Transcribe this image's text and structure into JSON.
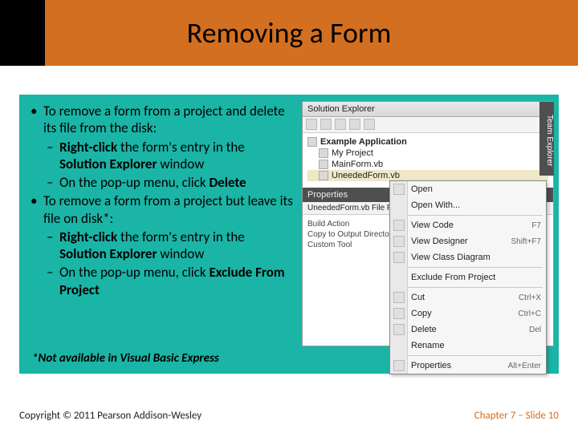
{
  "title": "Removing a Form",
  "bullets": {
    "b1a": "To remove a form from a project and delete its file from the disk:",
    "b1a_s1_pre": "Right-click ",
    "b1a_s1_mid": "the form's entry in the ",
    "b1a_s1_b2": "Solution Explorer ",
    "b1a_s1_post": "window",
    "b1a_s2_pre": "On the pop-up menu, click ",
    "b1a_s2_b": "Delete",
    "b1b": "To remove a form from a project but leave its file on disk*:",
    "b1b_s1_pre": "Right-click ",
    "b1b_s1_mid": "the form's entry in the ",
    "b1b_s1_b2": "Solution Explorer ",
    "b1b_s1_post": "window",
    "b1b_s2_pre": "On the pop-up menu, click ",
    "b1b_s2_b": "Exclude From Project"
  },
  "note": "*Not available in Visual Basic Express",
  "footer_left": "Copyright © 2011 Pearson Addison-Wesley",
  "footer_right": "Chapter 7 – Slide 10",
  "mock": {
    "se_title": "Solution Explorer",
    "sidebar_tab": "Team Explorer",
    "tree": {
      "root": "Example Application",
      "n1": "My Project",
      "n2": "MainForm.vb",
      "n3": "UneededForm.vb"
    },
    "ctx": {
      "open": "Open",
      "openwith": "Open With...",
      "viewcode": "View Code",
      "viewcode_sc": "F7",
      "viewdesigner": "View Designer",
      "viewdesigner_sc": "Shift+F7",
      "viewclass": "View Class Diagram",
      "exclude": "Exclude From Project",
      "cut": "Cut",
      "cut_sc": "Ctrl+X",
      "copy": "Copy",
      "copy_sc": "Ctrl+C",
      "delete": "Delete",
      "delete_sc": "Del",
      "rename": "Rename",
      "props": "Properties",
      "props_sc": "Alt+Enter"
    },
    "props_title": "Properties",
    "props_sub": "UneededForm.vb  File Properties",
    "p1": "Build Action",
    "p2": "Copy to Output Directory",
    "p3": "Custom Tool"
  }
}
